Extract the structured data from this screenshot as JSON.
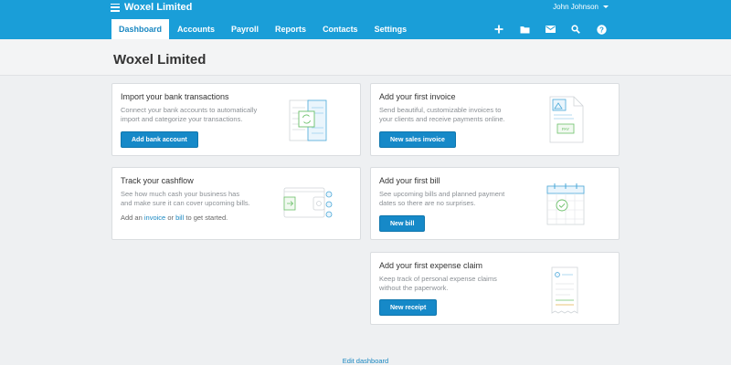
{
  "app": {
    "org_name": "Woxel Limited",
    "user_name": "John Johnson"
  },
  "nav": {
    "tabs": [
      {
        "label": "Dashboard",
        "active": true
      },
      {
        "label": "Accounts"
      },
      {
        "label": "Payroll"
      },
      {
        "label": "Reports"
      },
      {
        "label": "Contacts"
      },
      {
        "label": "Settings"
      }
    ],
    "actions": [
      "plus-icon",
      "folder-icon",
      "mail-icon",
      "search-icon",
      "help-icon"
    ]
  },
  "page": {
    "title": "Woxel Limited"
  },
  "cards": {
    "bank": {
      "title": "Import your bank transactions",
      "desc_line1": "Connect your bank accounts to automatically",
      "desc_line2": "import and categorize your transactions.",
      "button": "Add bank account"
    },
    "invoice": {
      "title": "Add your first invoice",
      "desc_line1": "Send beautiful, customizable invoices to",
      "desc_line2": "your clients and receive payments online.",
      "button": "New sales invoice",
      "illus_label": "PAY"
    },
    "cashflow": {
      "title": "Track your cashflow",
      "desc_line1": "See how much cash your business has",
      "desc_line2": "and make sure it can cover upcoming bills.",
      "extra_prefix": "Add an",
      "extra_link1": "invoice",
      "extra_mid": "or",
      "extra_link2": "bill",
      "extra_suffix": "to get started."
    },
    "bill": {
      "title": "Add your first bill",
      "desc_line1": "See upcoming bills and planned payment",
      "desc_line2": "dates so there are no surprises.",
      "button": "New bill"
    },
    "expense": {
      "title": "Add your first expense claim",
      "desc_line1": "Keep track of personal expense claims",
      "desc_line2": "without the paperwork.",
      "button": "New receipt"
    }
  },
  "footer": {
    "edit_link": "Edit dashboard"
  },
  "colors": {
    "brand": "#1a9ed8",
    "button": "#1689c8",
    "link": "#1a88c2",
    "illus_green": "#6cc06a",
    "illus_blue": "#4aa8d8"
  }
}
